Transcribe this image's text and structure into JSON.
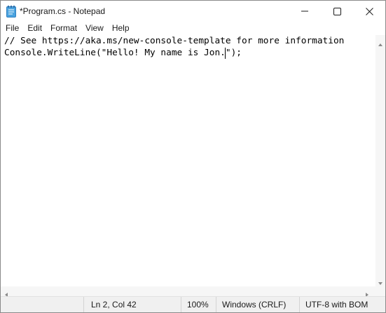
{
  "window": {
    "title": "*Program.cs - Notepad",
    "app_icon": "notepad-icon"
  },
  "caption_buttons": {
    "minimize_icon": "minimize-icon",
    "maximize_icon": "maximize-icon",
    "close_icon": "close-icon"
  },
  "menu": {
    "items": [
      "File",
      "Edit",
      "Format",
      "View",
      "Help"
    ]
  },
  "editor": {
    "lines": [
      "// See https://aka.ms/new-console-template for more information",
      "Console.WriteLine(\"Hello! My name is Jon.\");"
    ],
    "line2_before_caret": "Console.WriteLine(\"Hello! My name is Jon.",
    "line2_after_caret": "\");"
  },
  "status": {
    "position": "Ln 2, Col 42",
    "zoom": "100%",
    "line_ending": "Windows (CRLF)",
    "encoding": "UTF-8 with BOM"
  },
  "colors": {
    "accent_icon": "#3a8fd6",
    "status_bg": "#f0f0f0"
  }
}
